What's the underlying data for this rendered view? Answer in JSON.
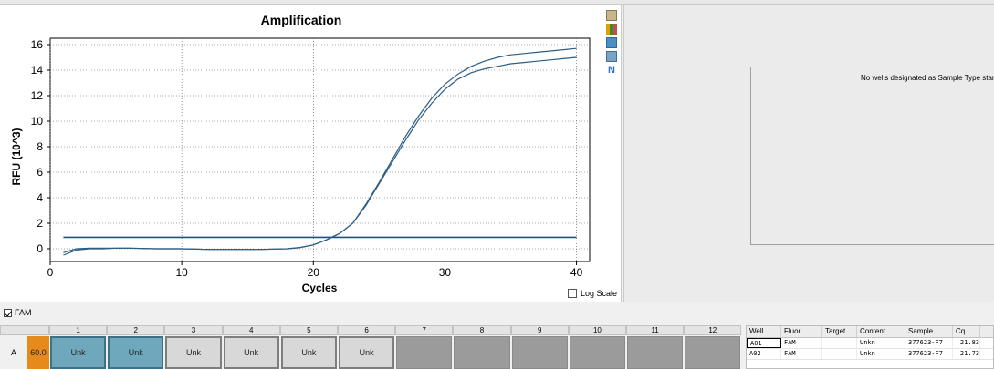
{
  "chart": {
    "title": "Amplification",
    "ylabel": "RFU (10^3)",
    "xlabel": "Cycles",
    "log_scale_label": "Log Scale"
  },
  "chart_data": {
    "type": "line",
    "title": "Amplification",
    "xlabel": "Cycles",
    "ylabel": "RFU (10^3)",
    "xlim": [
      0,
      41
    ],
    "ylim": [
      -1,
      16.5
    ],
    "x_ticks": [
      0,
      10,
      20,
      30,
      40
    ],
    "y_ticks": [
      0,
      2,
      4,
      6,
      8,
      10,
      12,
      14,
      16
    ],
    "grid": true,
    "threshold": 0.9,
    "series": [
      {
        "name": "A01",
        "color": "#2c5d84",
        "x": [
          1,
          2,
          3,
          4,
          5,
          6,
          8,
          10,
          12,
          14,
          16,
          18,
          19,
          20,
          21,
          22,
          23,
          24,
          25,
          26,
          27,
          28,
          29,
          30,
          31,
          32,
          33,
          34,
          35,
          36,
          37,
          38,
          39,
          40
        ],
        "values": [
          -0.5,
          -0.1,
          0.0,
          0.0,
          0.05,
          0.05,
          0.0,
          0.0,
          -0.05,
          -0.05,
          -0.05,
          0.0,
          0.1,
          0.3,
          0.7,
          1.2,
          2.0,
          3.5,
          5.2,
          7.0,
          8.8,
          10.4,
          11.8,
          12.9,
          13.7,
          14.3,
          14.7,
          15.0,
          15.2,
          15.3,
          15.4,
          15.5,
          15.6,
          15.7
        ]
      },
      {
        "name": "A02",
        "color": "#2c5d84",
        "x": [
          1,
          2,
          3,
          4,
          5,
          6,
          8,
          10,
          12,
          14,
          16,
          18,
          19,
          20,
          21,
          22,
          23,
          24,
          25,
          26,
          27,
          28,
          29,
          30,
          31,
          32,
          33,
          34,
          35,
          36,
          37,
          38,
          39,
          40
        ],
        "values": [
          -0.3,
          0.0,
          0.05,
          0.05,
          0.05,
          0.05,
          0.0,
          0.0,
          -0.05,
          -0.05,
          -0.05,
          0.0,
          0.1,
          0.3,
          0.7,
          1.2,
          2.0,
          3.4,
          5.1,
          6.8,
          8.5,
          10.1,
          11.4,
          12.5,
          13.3,
          13.8,
          14.1,
          14.3,
          14.5,
          14.6,
          14.7,
          14.8,
          14.9,
          15.0
        ]
      }
    ]
  },
  "right_panel": {
    "message": "No wells designated as Sample Type standa"
  },
  "fluor_filter": {
    "label": "FAM",
    "checked": true
  },
  "plate": {
    "columns": [
      "1",
      "2",
      "3",
      "4",
      "5",
      "6",
      "7",
      "8",
      "9",
      "10",
      "11",
      "12"
    ],
    "row_label": "A",
    "temp": "60.0",
    "wells": [
      {
        "label": "Unk",
        "state": "filled"
      },
      {
        "label": "Unk",
        "state": "filled"
      },
      {
        "label": "Unk",
        "state": "unk"
      },
      {
        "label": "Unk",
        "state": "unk"
      },
      {
        "label": "Unk",
        "state": "unk"
      },
      {
        "label": "Unk",
        "state": "unk"
      },
      {
        "label": "",
        "state": "empty"
      },
      {
        "label": "",
        "state": "empty"
      },
      {
        "label": "",
        "state": "empty"
      },
      {
        "label": "",
        "state": "empty"
      },
      {
        "label": "",
        "state": "empty"
      },
      {
        "label": "",
        "state": "empty"
      }
    ]
  },
  "results": {
    "headers": [
      "Well",
      "Fluor",
      "Target",
      "Content",
      "Sample",
      "Cq"
    ],
    "rows": [
      {
        "well": "A01",
        "fluor": "FAM",
        "target": "",
        "content": "Unkn",
        "sample": "377623-F7",
        "cq": "21.83"
      },
      {
        "well": "A02",
        "fluor": "FAM",
        "target": "",
        "content": "Unkn",
        "sample": "377623-F7",
        "cq": "21.73"
      }
    ]
  }
}
